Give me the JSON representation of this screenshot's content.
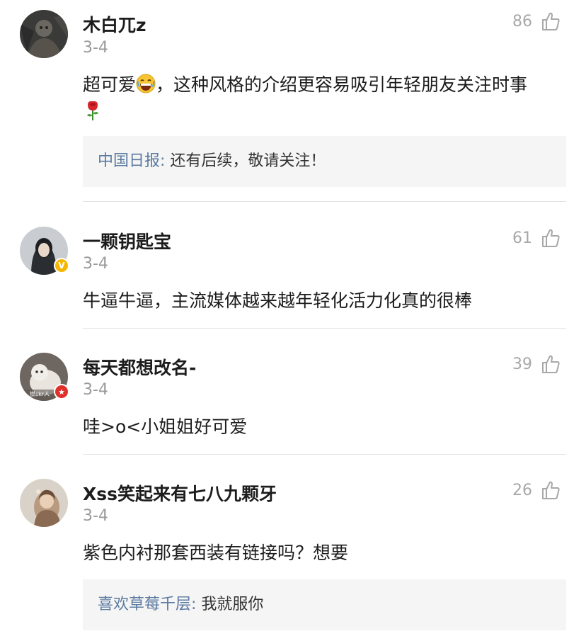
{
  "comments": [
    {
      "username": "木白兀z",
      "date": "3-4",
      "likes": "86",
      "text_before_emoji": "超可爱",
      "text_after_emoji": "，这种风格的介绍更容易吸引年轻朋友关注时事",
      "emojis": [
        "laughing-emoji",
        "rose-emoji"
      ],
      "reply": {
        "author": "中国日报",
        "separator": ": ",
        "text": "还有后续，敬请关注！"
      }
    },
    {
      "username": "一颗钥匙宝",
      "date": "3-4",
      "likes": "61",
      "badge": "V",
      "text": "牛逼牛逼，主流媒体越来越年轻化活力化真的很棒"
    },
    {
      "username": "每天都想改名-",
      "date": "3-4",
      "likes": "39",
      "badge": "★",
      "avatar_caption": "燃skr人",
      "text": "哇>o<小姐姐好可爱"
    },
    {
      "username": "Xss笑起来有七八九颗牙",
      "date": "3-4",
      "likes": "26",
      "text": "紫色内衬那套西装有链接吗？想要",
      "reply": {
        "author": "喜欢草莓千层",
        "separator": ": ",
        "text": "我就服你"
      }
    }
  ],
  "icons": {
    "like": "thumbs-up-icon"
  },
  "colors": {
    "reply_author": "#5b7aa0",
    "date": "#9a9a9a",
    "likes": "#a8a8a8",
    "reply_bg": "#f5f5f5",
    "badge_v": "#f5b700",
    "badge_star": "#e0302a"
  }
}
